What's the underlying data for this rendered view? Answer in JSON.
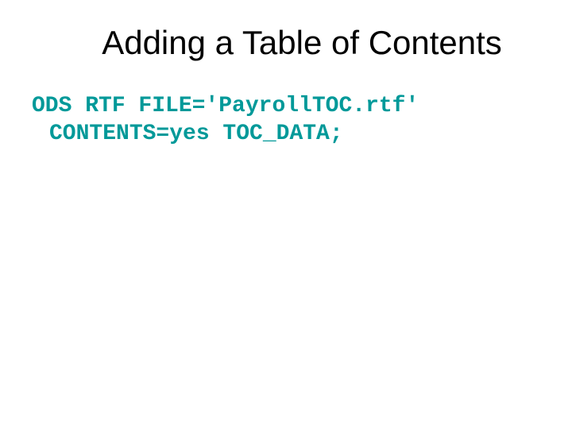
{
  "title": "Adding a Table of Contents",
  "code": {
    "line1": "ODS RTF FILE='PayrollTOC.rtf'",
    "line2": "CONTENTS=yes TOC_DATA;"
  }
}
